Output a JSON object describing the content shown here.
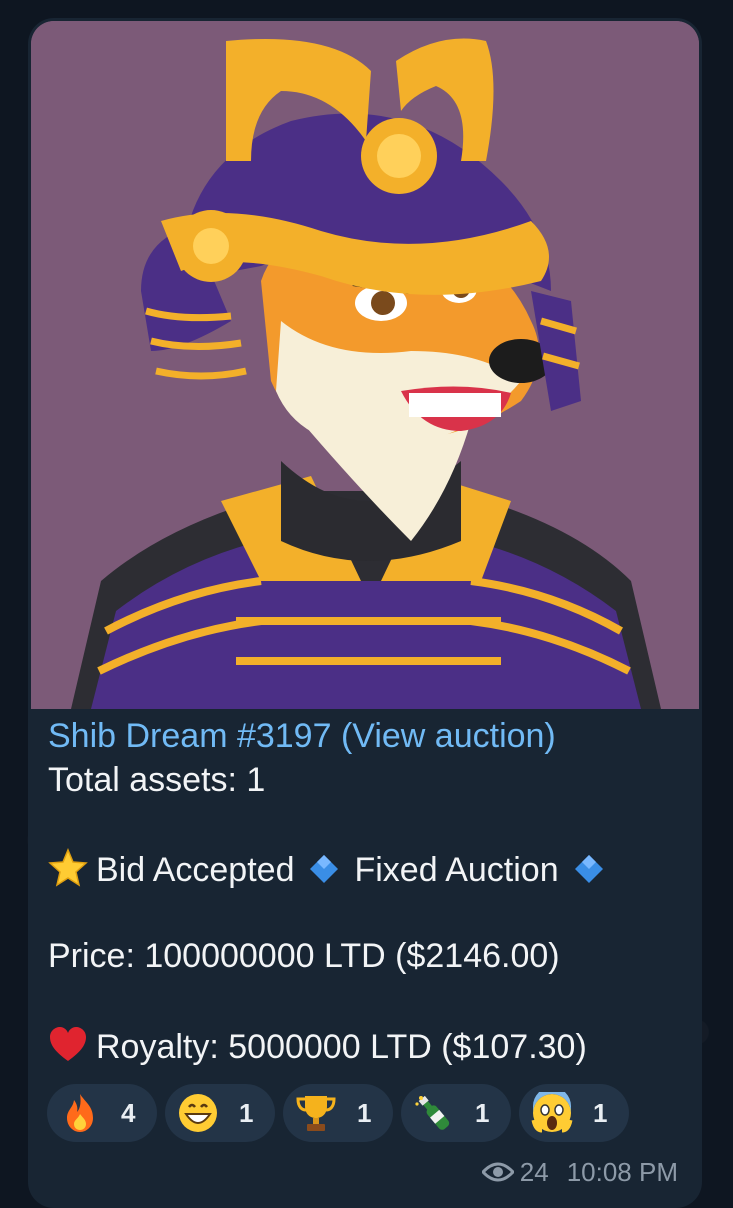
{
  "message": {
    "title_link": "Shib Dream #3197 (View auction)",
    "assets_line": "Total assets: 1",
    "status": {
      "bid": "Bid Accepted",
      "auction": "Fixed Auction"
    },
    "price_line": "Price: 100000000 LTD ($2146.00)",
    "royalty_line": "Royalty: 5000000 LTD ($107.30)"
  },
  "reactions": [
    {
      "icon": "fire",
      "count": "4"
    },
    {
      "icon": "grinning-face",
      "count": "1"
    },
    {
      "icon": "trophy",
      "count": "1"
    },
    {
      "icon": "champagne-bottle",
      "count": "1"
    },
    {
      "icon": "screaming-face",
      "count": "1"
    }
  ],
  "meta": {
    "views": "24",
    "time": "10:08 PM"
  },
  "colors": {
    "link": "#71baf5",
    "bubble": "#182533",
    "image_bg": "#7c5a78"
  }
}
